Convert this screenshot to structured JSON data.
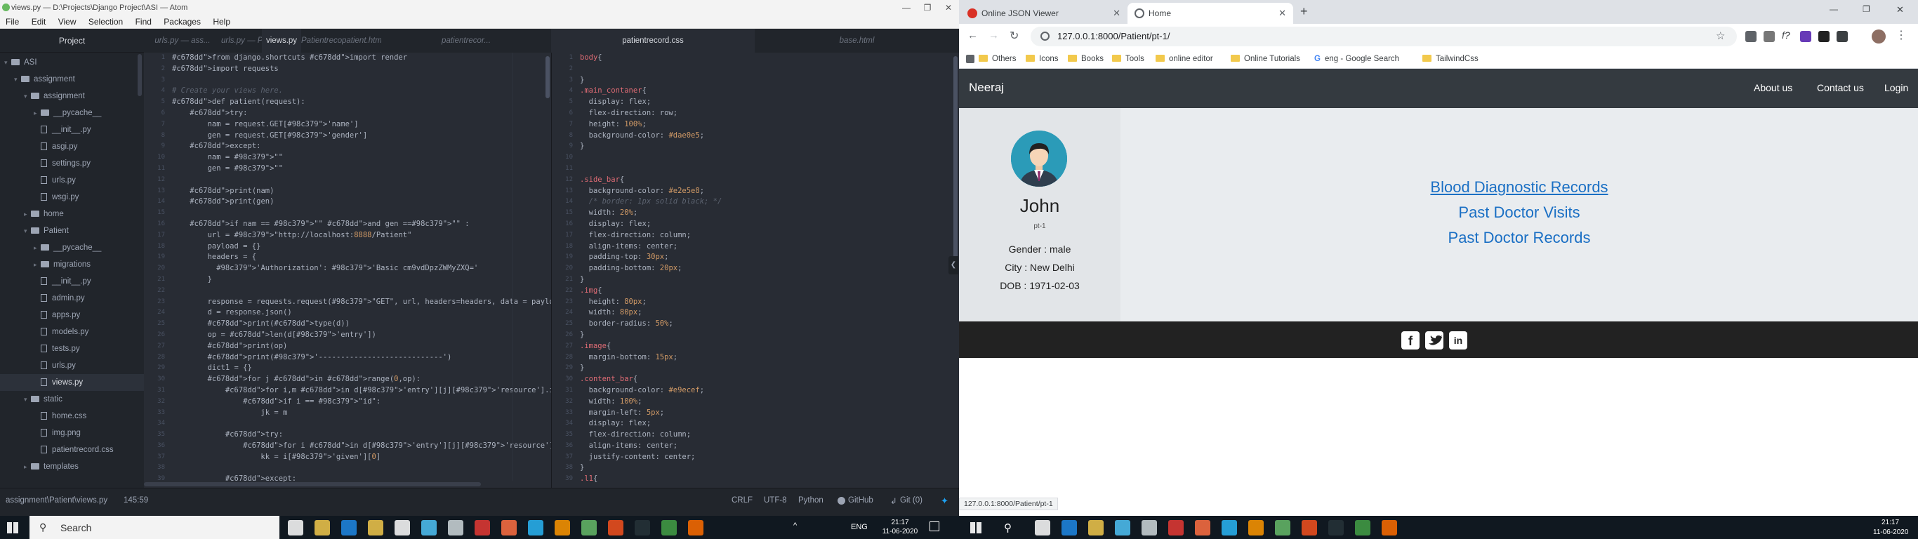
{
  "atom": {
    "title": "views.py — D:\\Projects\\Django Project\\ASI — Atom",
    "menu": [
      "File",
      "Edit",
      "View",
      "Selection",
      "Find",
      "Packages",
      "Help"
    ],
    "project_header": "Project",
    "tree": [
      {
        "label": "ASI",
        "kind": "folder",
        "depth": 0,
        "open": true
      },
      {
        "label": "assignment",
        "kind": "folder",
        "depth": 1,
        "open": true
      },
      {
        "label": "assignment",
        "kind": "folder",
        "depth": 2,
        "open": true
      },
      {
        "label": "__pycache__",
        "kind": "folder",
        "depth": 3,
        "open": false
      },
      {
        "label": "__init__.py",
        "kind": "file",
        "depth": 3
      },
      {
        "label": "asgi.py",
        "kind": "file",
        "depth": 3
      },
      {
        "label": "settings.py",
        "kind": "file",
        "depth": 3
      },
      {
        "label": "urls.py",
        "kind": "file",
        "depth": 3
      },
      {
        "label": "wsgi.py",
        "kind": "file",
        "depth": 3
      },
      {
        "label": "home",
        "kind": "folder",
        "depth": 2,
        "open": false
      },
      {
        "label": "Patient",
        "kind": "folder",
        "depth": 2,
        "open": true
      },
      {
        "label": "__pycache__",
        "kind": "folder",
        "depth": 3,
        "open": false
      },
      {
        "label": "migrations",
        "kind": "folder",
        "depth": 3,
        "open": false
      },
      {
        "label": "__init__.py",
        "kind": "file",
        "depth": 3
      },
      {
        "label": "admin.py",
        "kind": "file",
        "depth": 3
      },
      {
        "label": "apps.py",
        "kind": "file",
        "depth": 3
      },
      {
        "label": "models.py",
        "kind": "file",
        "depth": 3
      },
      {
        "label": "tests.py",
        "kind": "file",
        "depth": 3
      },
      {
        "label": "urls.py",
        "kind": "file",
        "depth": 3
      },
      {
        "label": "views.py",
        "kind": "file",
        "depth": 3,
        "selected": true
      },
      {
        "label": "static",
        "kind": "folder",
        "depth": 2,
        "open": true
      },
      {
        "label": "home.css",
        "kind": "file",
        "depth": 3
      },
      {
        "label": "img.png",
        "kind": "file",
        "depth": 3
      },
      {
        "label": "patientrecord.css",
        "kind": "file",
        "depth": 3
      },
      {
        "label": "templates",
        "kind": "folder",
        "depth": 2,
        "open": false
      }
    ],
    "tabs_left": [
      {
        "label": "urls.py — ass...",
        "active": false
      },
      {
        "label": "urls.py — Pat...",
        "active": false
      },
      {
        "label": "views.py",
        "active": true
      },
      {
        "label": "Patientrecord...",
        "active": false
      },
      {
        "label": "patient.html",
        "active": false
      },
      {
        "label": "patientrecor...",
        "active": false
      }
    ],
    "tabs_right": [
      {
        "label": "patientrecord.css",
        "active": true
      },
      {
        "label": "base.html",
        "active": false
      }
    ],
    "code_left": [
      "from django.shortcuts import render",
      "import requests",
      "",
      "# Create your views here.",
      "def patient(request):",
      "    try:",
      "        nam = request.GET['name']",
      "        gen = request.GET['gender']",
      "    except:",
      "        nam = \"\"",
      "        gen = \"\"",
      "",
      "    print(nam)",
      "    print(gen)",
      "",
      "    if nam == \"\" and gen ==\"\" :",
      "        url = \"http://localhost:8888/Patient\"",
      "        payload = {}",
      "        headers = {",
      "          'Authorization': 'Basic cm9vdDpzZWMyZXQ='",
      "        }",
      "",
      "        response = requests.request(\"GET\", url, headers=headers, data = payload)",
      "        d = response.json()",
      "        print(type(d))",
      "        op = len(d['entry'])",
      "        print(op)",
      "        print('----------------------------')",
      "        dict1 = {}",
      "        for j in range(0,op):",
      "            for i,m in d['entry'][j]['resource'].items():",
      "                if i == \"id\":",
      "                    jk = m",
      "",
      "            try:",
      "                for i in d['entry'][j]['resource']['name']:",
      "                    kk = i['given'][0]",
      "",
      "            except:"
    ],
    "code_right": [
      "body{",
      "",
      "}",
      ".main_contaner{",
      "  display: flex;",
      "  flex-direction: row;",
      "  height: 100%;",
      "  background-color: #dae0e5;",
      "}",
      "",
      "",
      ".side_bar{",
      "  background-color: #e2e5e8;",
      "  /* border: 1px solid black; */",
      "  width: 20%;",
      "  display: flex;",
      "  flex-direction: column;",
      "  align-items: center;",
      "  padding-top: 30px;",
      "  padding-bottom: 20px;",
      "}",
      ".img{",
      "  height: 80px;",
      "  width: 80px;",
      "  border-radius: 50%;",
      "}",
      ".image{",
      "  margin-bottom: 15px;",
      "}",
      ".content_bar{",
      "  background-color: #e9ecef;",
      "  width: 100%;",
      "  margin-left: 5px;",
      "  display: flex;",
      "  flex-direction: column;",
      "  align-items: center;",
      "  justify-content: center;",
      "}",
      ".l1{"
    ],
    "status": {
      "path": "assignment\\Patient\\views.py",
      "cursor": "145:59",
      "line_ending": "CRLF",
      "encoding": "UTF-8",
      "grammar": "Python",
      "github": "GitHub",
      "git": "Git (0)"
    }
  },
  "chrome": {
    "tabs": [
      {
        "label": "Online JSON Viewer",
        "active": false
      },
      {
        "label": "Home",
        "active": true
      }
    ],
    "url": "127.0.0.1:8000/Patient/pt-1/",
    "bookmarks": [
      "Others",
      "Icons",
      "Books",
      "Tools",
      "online editor",
      "Online Tutorials",
      "eng - Google Search",
      "TailwindCss"
    ],
    "status_url": "127.0.0.1:8000/Patient/pt-1"
  },
  "site": {
    "brand": "Neeraj",
    "nav": [
      "About us",
      "Contact us",
      "Login"
    ],
    "patient": {
      "name": "John",
      "id": "pt-1",
      "gender": "Gender : male",
      "city": "City : New Delhi",
      "dob": "DOB : 1971-02-03"
    },
    "links": [
      "Blood Diagnostic Records",
      "Past Doctor Visits",
      "Past Doctor Records"
    ],
    "social": [
      "facebook-icon",
      "twitter-icon",
      "linkedin-icon"
    ]
  },
  "taskbar": {
    "search": "Search",
    "lang": "ENG",
    "time": "21:17",
    "date": "11-06-2020"
  },
  "colors": {
    "atom_bg": "#282c34",
    "navbar": "#343a40",
    "sidebar": "#e2e5e8",
    "content": "#e9ecef",
    "link": "#1a6fc4"
  }
}
